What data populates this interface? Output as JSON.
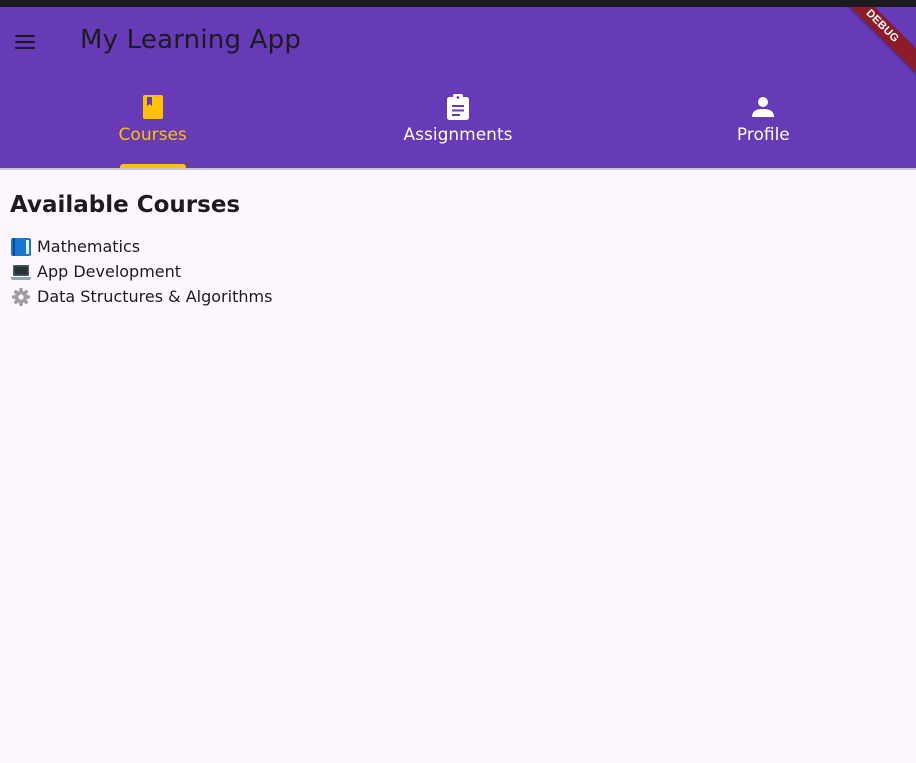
{
  "app_bar": {
    "title": "My Learning App",
    "debug_label": "DEBUG",
    "background_color": "#673ab7",
    "menu_icon": "menu-icon"
  },
  "tabs": [
    {
      "label": "Courses",
      "icon": "book-icon",
      "active": true
    },
    {
      "label": "Assignments",
      "icon": "assignment-icon",
      "active": false
    },
    {
      "label": "Profile",
      "icon": "person-icon",
      "active": false
    }
  ],
  "accent_color": "#ffc107",
  "main": {
    "section_title": "Available Courses",
    "courses": [
      {
        "icon": "blue-book-icon",
        "label": "Mathematics"
      },
      {
        "icon": "laptop-icon",
        "label": "App Development"
      },
      {
        "icon": "gear-icon",
        "label": "Data Structures & Algorithms"
      }
    ]
  }
}
